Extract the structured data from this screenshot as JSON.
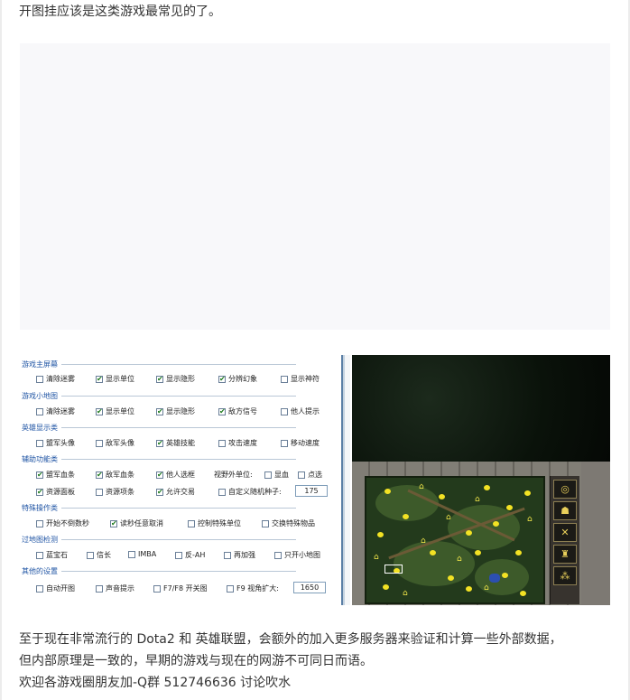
{
  "article": {
    "intro": "开图挂应该是这类游戏最常见的了。",
    "paragraph1": "至于现在非常流行的 Dota2 和 英雄联盟，会额外的加入更多服务器来验证和计算一些外部数据，",
    "paragraph2": "但内部原理是一致的，早期的游戏与现在的网游不可同日而语。",
    "paragraph3": "欢迎各游戏圈朋友加-Q群 512746636 讨论吹水"
  },
  "cheat_panel": {
    "sections": [
      {
        "title": "游戏主屏幕",
        "options": [
          {
            "label": "清除迷雾",
            "checked": false
          },
          {
            "label": "显示单位",
            "checked": true
          },
          {
            "label": "显示隐形",
            "checked": true
          },
          {
            "label": "分辨幻象",
            "checked": true
          },
          {
            "label": "显示神符",
            "checked": false
          }
        ]
      },
      {
        "title": "游戏小地图",
        "options": [
          {
            "label": "清除迷雾",
            "checked": false
          },
          {
            "label": "显示单位",
            "checked": true
          },
          {
            "label": "显示隐形",
            "checked": true
          },
          {
            "label": "敌方信号",
            "checked": true
          },
          {
            "label": "他人提示",
            "checked": false
          }
        ]
      },
      {
        "title": "英雄显示类",
        "options": [
          {
            "label": "盟军头像",
            "checked": false
          },
          {
            "label": "敌军头像",
            "checked": false
          },
          {
            "label": "英雄技能",
            "checked": true
          },
          {
            "label": "攻击速度",
            "checked": false
          },
          {
            "label": "移动速度",
            "checked": false
          }
        ]
      },
      {
        "title": "辅助功能类",
        "options": [
          {
            "label": "盟军血条",
            "checked": true
          },
          {
            "label": "敌军血条",
            "checked": true
          },
          {
            "label": "他人选框",
            "checked": true
          },
          {
            "label": "视野外单位:",
            "checked": null
          },
          {
            "label": "显血",
            "checked": false
          },
          {
            "label": "点选",
            "checked": false
          },
          {
            "label": "资源面板",
            "checked": true
          },
          {
            "label": "资源项条",
            "checked": false
          },
          {
            "label": "允许交易",
            "checked": true
          },
          {
            "label": "自定义随机种子:",
            "checked": false
          }
        ],
        "seed_value": "175"
      },
      {
        "title": "特殊操作类",
        "options": [
          {
            "label": "开始不倒数秒",
            "checked": false
          },
          {
            "label": "读秒任意取消",
            "checked": true
          },
          {
            "label": "控制特殊单位",
            "checked": false
          },
          {
            "label": "交换特殊物品",
            "checked": false
          }
        ]
      },
      {
        "title": "过地图检测",
        "options": [
          {
            "label": "蓝宝石",
            "checked": false
          },
          {
            "label": "信长",
            "checked": false
          },
          {
            "label": "IMBA",
            "checked": false
          },
          {
            "label": "反-AH",
            "checked": false
          },
          {
            "label": "再加强",
            "checked": false
          },
          {
            "label": "只开小地图",
            "checked": false
          }
        ]
      },
      {
        "title": "其他的设置",
        "options": [
          {
            "label": "自动开图",
            "checked": false
          },
          {
            "label": "声音提示",
            "checked": false
          },
          {
            "label": "F7/F8 开关图",
            "checked": false
          },
          {
            "label": "F9 视角扩大:",
            "checked": false
          }
        ],
        "zoom_value": "1650"
      }
    ]
  },
  "game_view": {
    "minimap_buttons": [
      "signal-icon",
      "ally-icon",
      "crossed-swords-icon",
      "formation-icon",
      "creeps-icon"
    ]
  }
}
